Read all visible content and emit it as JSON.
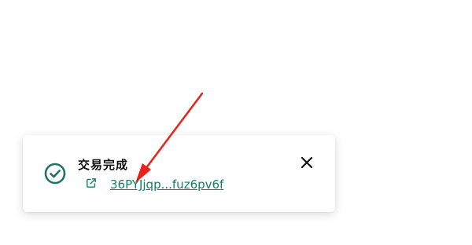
{
  "notification": {
    "title": "交易完成",
    "link_text": "36PYJjqp...fuz6pv6f",
    "success_icon": "check-circle-icon",
    "link_icon": "external-link-icon",
    "close_icon": "close-icon"
  },
  "colors": {
    "accent": "#118060",
    "icon": "#1e7466",
    "annotation": "#e8221b"
  }
}
